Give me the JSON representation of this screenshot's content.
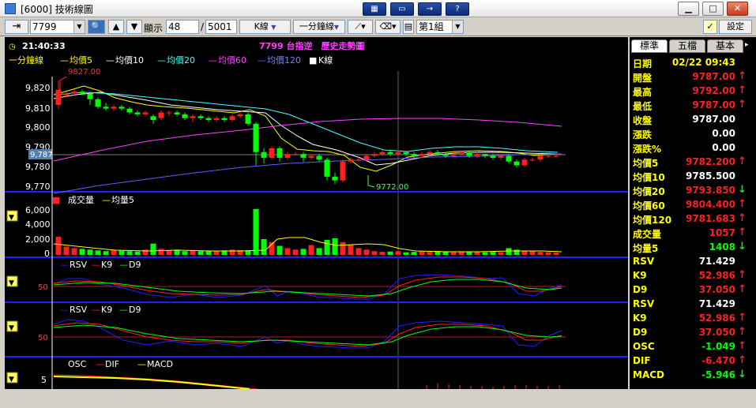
{
  "window": {
    "title": "[6000] 技術線圖",
    "colors": {
      "up": "#ff2020",
      "down": "#00ff00",
      "label": "#ffff00",
      "axis": "#0000ff"
    }
  },
  "toolbar": {
    "stock_code": "7799",
    "display_label": "顯示",
    "display_count": "48",
    "separator": "/",
    "total_count": "5001",
    "chart_type": "K線",
    "period": "一分鐘線",
    "group": "第1組",
    "settings_label": "設定"
  },
  "chart": {
    "time": "21:40:33",
    "title": "7799 台指逆　歷史走勢圖",
    "price_legend": [
      "一分鐘線",
      "均價5",
      "均價10",
      "均價20",
      "均價60",
      "均價120",
      "K線"
    ],
    "price_ticks": [
      "9,820",
      "9,810",
      "9,800",
      "9,790",
      "9,780",
      "9,770"
    ],
    "current_price_marker": "9,787",
    "high_annotation": "9827.00",
    "low_annotation": "9772.00",
    "volume_legend": [
      "成交量",
      "均量5"
    ],
    "volume_ticks": [
      "6,000",
      "4,000",
      "2,000",
      "0"
    ],
    "rsv_legend_1": [
      "RSV",
      "K9",
      "D9"
    ],
    "rsv_legend_2": [
      "RSV",
      "K9",
      "D9"
    ],
    "rsv_tick": "50",
    "macd_legend": [
      "OSC",
      "DIF",
      "MACD"
    ],
    "macd_tick": "5"
  },
  "chart_data": {
    "type": "candlestick",
    "price_range": [
      9768,
      9829
    ],
    "candles": [
      [
        9814,
        9822,
        9812,
        9827
      ],
      [
        9819,
        9820,
        9818,
        9821
      ],
      [
        9820,
        9821,
        9819,
        9822
      ],
      [
        9821,
        9820,
        9819,
        9822
      ],
      [
        9820,
        9817,
        9814,
        9821
      ],
      [
        9817,
        9813,
        9812,
        9818
      ],
      [
        9813,
        9812,
        9811,
        9815
      ],
      [
        9812,
        9813,
        9811,
        9814
      ],
      [
        9813,
        9812,
        9811,
        9814
      ],
      [
        9812,
        9810,
        9809,
        9813
      ],
      [
        9810,
        9809,
        9808,
        9811
      ],
      [
        9809,
        9810,
        9808,
        9811
      ],
      [
        9808,
        9806,
        9804,
        9809
      ],
      [
        9807,
        9810,
        9806,
        9811
      ],
      [
        9810,
        9810,
        9808,
        9811
      ],
      [
        9810,
        9809,
        9808,
        9811
      ],
      [
        9809,
        9807,
        9806,
        9810
      ],
      [
        9807,
        9808,
        9805,
        9809
      ],
      [
        9808,
        9807,
        9806,
        9809
      ],
      [
        9807,
        9806,
        9805,
        9808
      ],
      [
        9806,
        9807,
        9805,
        9808
      ],
      [
        9807,
        9806,
        9805,
        9808
      ],
      [
        9806,
        9808,
        9805,
        9809
      ],
      [
        9808,
        9809,
        9807,
        9810
      ],
      [
        9809,
        9804,
        9803,
        9810
      ],
      [
        9804,
        9789,
        9782,
        9805
      ],
      [
        9789,
        9786,
        9783,
        9791
      ],
      [
        9786,
        9791,
        9785,
        9792
      ],
      [
        9791,
        9786,
        9784,
        9792
      ],
      [
        9786,
        9788,
        9785,
        9789
      ],
      [
        9788,
        9788,
        9787,
        9789
      ],
      [
        9788,
        9786,
        9784,
        9789
      ],
      [
        9786,
        9787,
        9785,
        9788
      ],
      [
        9787,
        9785,
        9784,
        9788
      ],
      [
        9785,
        9776,
        9774,
        9786
      ],
      [
        9776,
        9774,
        9772,
        9778
      ],
      [
        9774,
        9784,
        9773,
        9785
      ],
      [
        9784,
        9785,
        9783,
        9786
      ],
      [
        9785,
        9785,
        9784,
        9786
      ],
      [
        9785,
        9787,
        9784,
        9788
      ],
      [
        9787,
        9788,
        9786,
        9789
      ],
      [
        9788,
        9789,
        9787,
        9790
      ],
      [
        9789,
        9788,
        9787,
        9790
      ],
      [
        9788,
        9789,
        9787,
        9790
      ],
      [
        9789,
        9788,
        9787,
        9789
      ],
      [
        9788,
        9787,
        9786,
        9789
      ],
      [
        9787,
        9788,
        9786,
        9789
      ],
      [
        9788,
        9789,
        9787,
        9790
      ],
      [
        9789,
        9788,
        9787,
        9790
      ],
      [
        9788,
        9787,
        9786,
        9789
      ],
      [
        9787,
        9788,
        9786,
        9789
      ],
      [
        9788,
        9789,
        9787,
        9790
      ],
      [
        9789,
        9787,
        9786,
        9790
      ],
      [
        9787,
        9788,
        9786,
        9789
      ],
      [
        9788,
        9787,
        9786,
        9788
      ],
      [
        9787,
        9786,
        9785,
        9788
      ],
      [
        9786,
        9787,
        9785,
        9788
      ],
      [
        9787,
        9784,
        9783,
        9788
      ],
      [
        9784,
        9782,
        9781,
        9785
      ],
      [
        9782,
        9785,
        9781,
        9786
      ],
      [
        9785,
        9785,
        9784,
        9786
      ],
      [
        9785,
        9787,
        9784,
        9788
      ],
      [
        9787,
        9787,
        9786,
        9788
      ],
      [
        9787,
        9787,
        9786,
        9788
      ]
    ],
    "volumes": [
      2400,
      1100,
      900,
      800,
      700,
      600,
      500,
      600,
      550,
      500,
      450,
      700,
      1500,
      800,
      600,
      700,
      500,
      650,
      500,
      500,
      550,
      600,
      700,
      650,
      600,
      6100,
      2100,
      1700,
      1200,
      900,
      700,
      800,
      1300,
      900,
      2000,
      2200,
      1700,
      1300,
      900,
      700,
      500,
      400,
      450,
      500,
      350,
      400,
      450,
      400,
      500,
      400,
      350,
      400,
      450,
      400,
      350,
      400,
      350,
      900,
      700,
      500,
      500,
      400,
      350,
      300
    ],
    "volume_range": [
      0,
      6500
    ]
  },
  "quote": {
    "tabs": [
      "標準",
      "五檔",
      "基本"
    ],
    "rows": [
      {
        "label": "日期",
        "value": "02/22 09:43",
        "color": "#ffff00",
        "arrow": ""
      },
      {
        "label": "開盤",
        "value": "9787.00",
        "color": "#ff2020",
        "arrow": "↑"
      },
      {
        "label": "最高",
        "value": "9792.00",
        "color": "#ff2020",
        "arrow": "↑"
      },
      {
        "label": "最低",
        "value": "9787.00",
        "color": "#ff2020",
        "arrow": "↑"
      },
      {
        "label": "收盤",
        "value": "9787.00",
        "color": "#ffffff",
        "arrow": ""
      },
      {
        "label": "漲跌",
        "value": "0.00",
        "color": "#ffffff",
        "arrow": ""
      },
      {
        "label": "漲跌%",
        "value": "0.00",
        "color": "#ffffff",
        "arrow": ""
      },
      {
        "label": "均價5",
        "value": "9782.200",
        "color": "#ff2020",
        "arrow": "↑"
      },
      {
        "label": "均價10",
        "value": "9785.500",
        "color": "#ffffff",
        "arrow": ""
      },
      {
        "label": "均價20",
        "value": "9793.850",
        "color": "#ff2020",
        "arrow": "↓"
      },
      {
        "label": "均價60",
        "value": "9804.400",
        "color": "#ff2020",
        "arrow": "↑"
      },
      {
        "label": "均價120",
        "value": "9781.683",
        "color": "#ff2020",
        "arrow": "↑"
      },
      {
        "label": "成交量",
        "value": "1057",
        "color": "#ff2020",
        "arrow": "↑"
      },
      {
        "label": "均量5",
        "value": "1408",
        "color": "#00ff00",
        "arrow": "↓"
      },
      {
        "label": "RSV",
        "value": "71.429",
        "color": "#ffffff",
        "arrow": ""
      },
      {
        "label": "K9",
        "value": "52.986",
        "color": "#ff2020",
        "arrow": "↑"
      },
      {
        "label": "D9",
        "value": "37.050",
        "color": "#ff2020",
        "arrow": "↑"
      },
      {
        "label": "RSV",
        "value": "71.429",
        "color": "#ffffff",
        "arrow": ""
      },
      {
        "label": "K9",
        "value": "52.986",
        "color": "#ff2020",
        "arrow": "↑"
      },
      {
        "label": "D9",
        "value": "37.050",
        "color": "#ff2020",
        "arrow": "↑"
      },
      {
        "label": "OSC",
        "value": "-1.049",
        "color": "#00ff00",
        "arrow": "↑"
      },
      {
        "label": "DIF",
        "value": "-6.470",
        "color": "#ff2020",
        "arrow": "↑"
      },
      {
        "label": "MACD",
        "value": "-5.946",
        "color": "#00ff00",
        "arrow": "↓"
      }
    ]
  }
}
